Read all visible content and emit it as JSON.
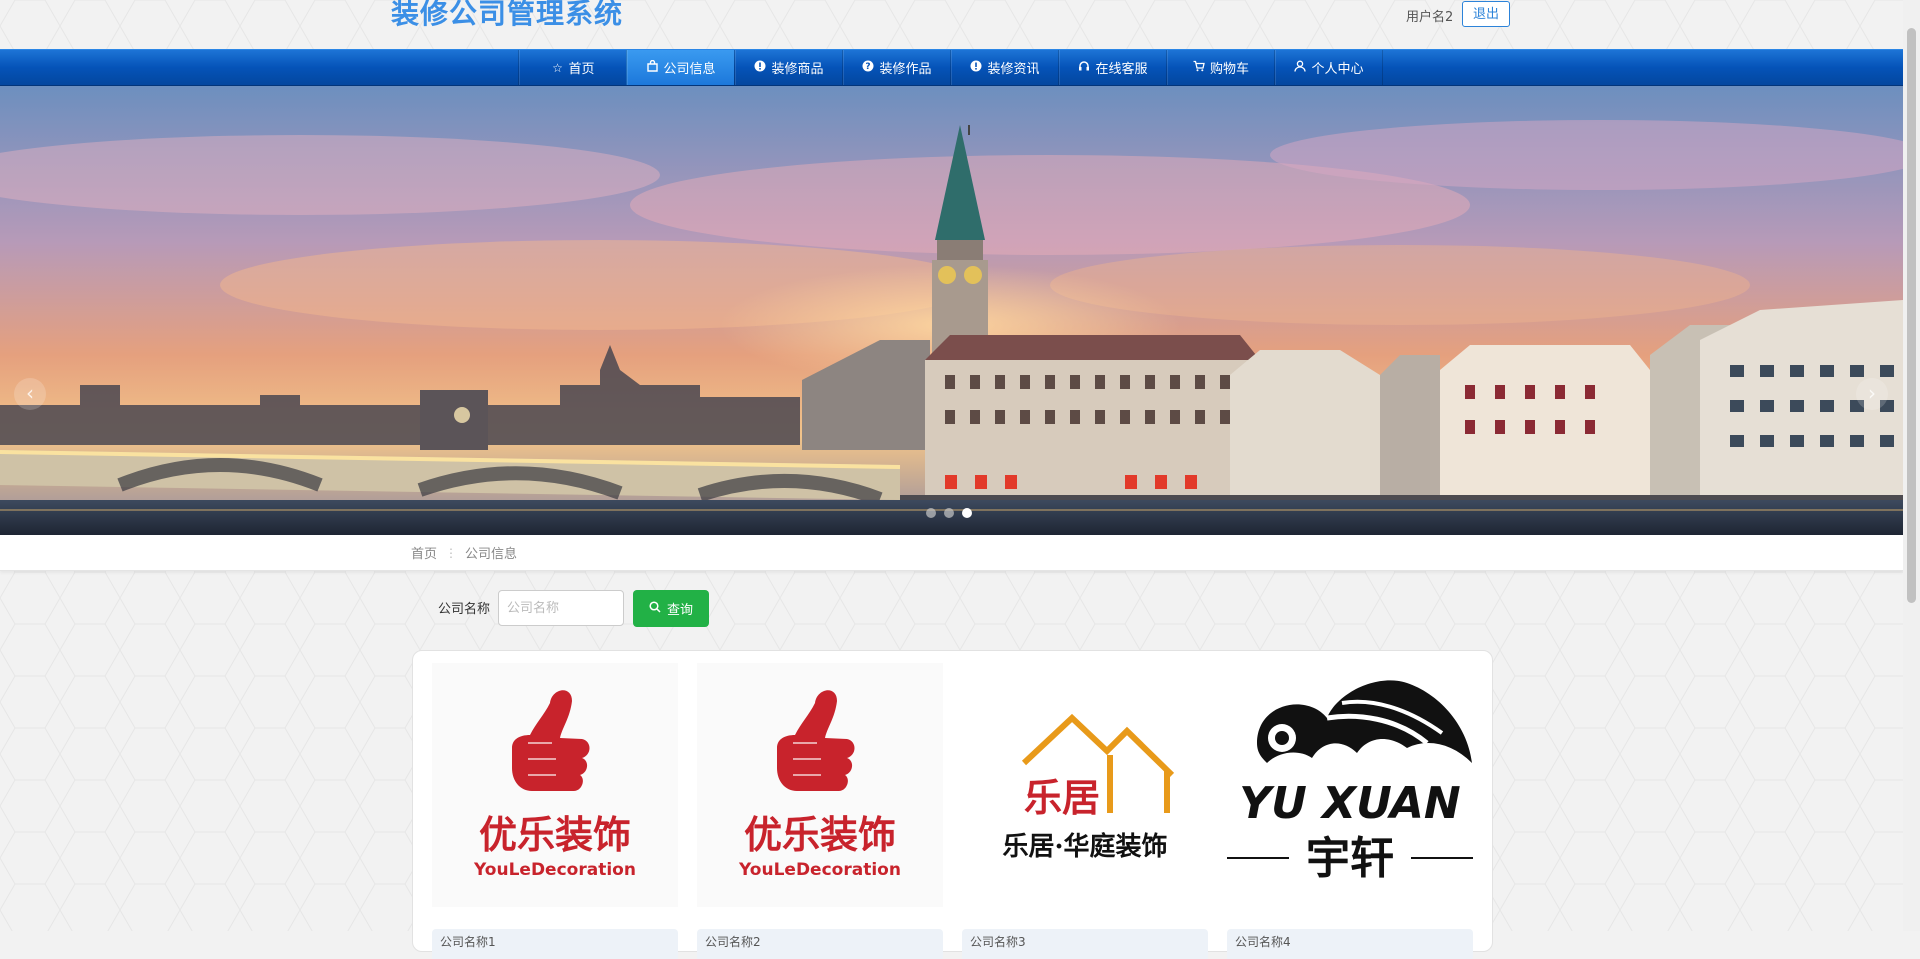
{
  "app": {
    "title": "装修公司管理系统"
  },
  "header": {
    "username": "用户名2",
    "logout_label": "退出"
  },
  "nav": {
    "items": [
      {
        "label": "首页",
        "icon": "star-icon"
      },
      {
        "label": "公司信息",
        "icon": "shop-icon",
        "active": true
      },
      {
        "label": "装修商品",
        "icon": "info-icon"
      },
      {
        "label": "装修作品",
        "icon": "help-icon"
      },
      {
        "label": "装修资讯",
        "icon": "info-icon"
      },
      {
        "label": "在线客服",
        "icon": "headset-icon"
      },
      {
        "label": "购物车",
        "icon": "cart-icon"
      },
      {
        "label": "个人中心",
        "icon": "user-icon"
      }
    ]
  },
  "carousel": {
    "slide_count": 3,
    "active_slide": 3,
    "prev_glyph": "‹",
    "next_glyph": "›"
  },
  "breadcrumb": {
    "home": "首页",
    "current": "公司信息",
    "separator": "⋮"
  },
  "search": {
    "label": "公司名称",
    "placeholder": "公司名称",
    "value": "",
    "button_label": "查询"
  },
  "companies": [
    {
      "name": "公司名称1",
      "logo_text": "优乐装饰",
      "logo_sub": "YouLeDecoration"
    },
    {
      "name": "公司名称2",
      "logo_text": "优乐装饰",
      "logo_sub": "YouLeDecoration"
    },
    {
      "name": "公司名称3",
      "logo_text": "乐居",
      "logo_sub": "乐居·华庭装饰"
    },
    {
      "name": "公司名称4",
      "logo_text": "YU XUAN",
      "logo_sub": "宇轩"
    }
  ],
  "colors": {
    "nav": "#0553b8",
    "accent": "#3b8fe6",
    "search_button": "#22b146",
    "logo_red": "#c8232c",
    "logo_orange": "#e89a1a"
  }
}
